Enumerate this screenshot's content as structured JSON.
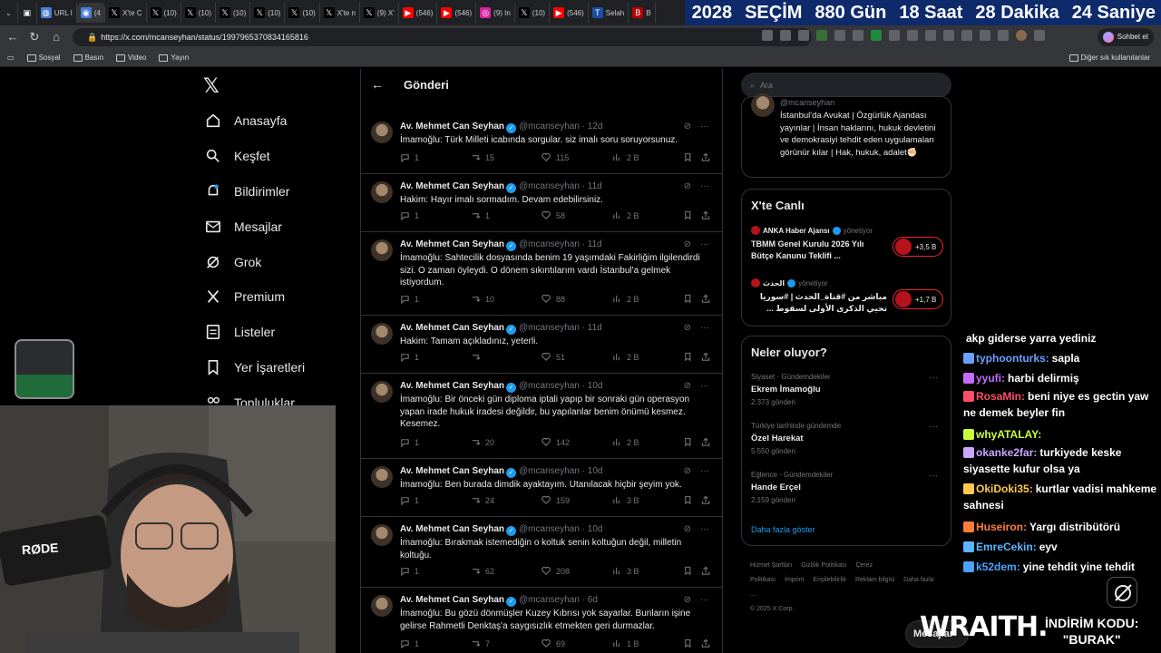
{
  "browser": {
    "tabs": [
      {
        "label": "URL I",
        "icon": "earth"
      },
      {
        "label": "(4",
        "icon": "circle"
      },
      {
        "label": "X'te C",
        "icon": "x"
      },
      {
        "label": "(10) ",
        "icon": "x"
      },
      {
        "label": "(10) ",
        "icon": "x"
      },
      {
        "label": "(10) ",
        "icon": "x"
      },
      {
        "label": "(10) ",
        "icon": "x"
      },
      {
        "label": "(10) ",
        "icon": "x"
      },
      {
        "label": "X'te n",
        "icon": "x"
      },
      {
        "label": "(9) X'",
        "icon": "x"
      },
      {
        "label": "(546)",
        "icon": "youtube"
      },
      {
        "label": "(546)",
        "icon": "youtube"
      },
      {
        "label": "(9) In",
        "icon": "instagram"
      },
      {
        "label": "(10) ",
        "icon": "x"
      },
      {
        "label": "(546)",
        "icon": "youtube"
      },
      {
        "label": "Selah",
        "icon": "tbn"
      },
      {
        "label": "B",
        "icon": "b"
      }
    ],
    "countdown": {
      "year": "2028",
      "label": "SEÇİM",
      "days": "880 Gün",
      "hours": "18 Saat",
      "minutes": "28 Dakika",
      "seconds": "24 Saniye"
    },
    "url": "https://x.com/mcanseyhan/status/1997965370834165816",
    "chat_button": "Sohbet et",
    "bookmarks": [
      "Sosyal",
      "Basın",
      "Video",
      "Yayın"
    ],
    "other_bookmarks": "Diğer sık kullanılanlar"
  },
  "nav": {
    "items": [
      {
        "label": "Anasayfa",
        "icon": "home-icon"
      },
      {
        "label": "Keşfet",
        "icon": "search-icon"
      },
      {
        "label": "Bildirimler",
        "icon": "bell-icon"
      },
      {
        "label": "Mesajlar",
        "icon": "mail-icon"
      },
      {
        "label": "Grok",
        "icon": "grok-icon"
      },
      {
        "label": "Premium",
        "icon": "x-icon"
      },
      {
        "label": "Listeler",
        "icon": "list-icon"
      },
      {
        "label": "Yer İşaretleri",
        "icon": "bookmark-icon"
      },
      {
        "label": "Topluluklar",
        "icon": "people-icon"
      }
    ]
  },
  "column": {
    "title": "Gönderi"
  },
  "tweets": [
    {
      "name": "Av. Mehmet Can Seyhan",
      "handle": "@mcanseyhan",
      "date": "· 12d",
      "text": "İmamoğlu: Türk Milleti icabında sorgular. siz imalı soru soruyorsunuz.",
      "replies": "1",
      "reposts": "15",
      "likes": "115",
      "views": "2 B"
    },
    {
      "name": "Av. Mehmet Can Seyhan",
      "handle": "@mcanseyhan",
      "date": "· 11d",
      "text": "Hakim: Hayır imalı sormadım. Devam edebilirsiniz.",
      "replies": "1",
      "reposts": "1",
      "likes": "58",
      "views": "2 B"
    },
    {
      "name": "Av. Mehmet Can Seyhan",
      "handle": "@mcanseyhan",
      "date": "· 11d",
      "text": "İmamoğlu: Sahtecilik dosyasında benim 19 yaşımdaki Fakirliğim ilgilendirdi sizi. O zaman öyleydi. O dönem sıkıntılarım vardı İstanbul'a gelmek istiyordum.",
      "replies": "1",
      "reposts": "10",
      "likes": "88",
      "views": "2 B"
    },
    {
      "name": "Av. Mehmet Can Seyhan",
      "handle": "@mcanseyhan",
      "date": "· 11d",
      "text": "Hakim: Tamam açıkladınız, yeterli.",
      "replies": "1",
      "reposts": "",
      "likes": "51",
      "views": "2 B"
    },
    {
      "name": "Av. Mehmet Can Seyhan",
      "handle": "@mcanseyhan",
      "date": "· 10d",
      "text": "İmamoğlu: Bir önceki gün diploma iptali yapıp bir sonraki gün operasyon yapan irade hukuk iradesi değildir, bu yapılanlar benim önümü kesmez. Kesemez.",
      "replies": "1",
      "reposts": "20",
      "likes": "142",
      "views": "2 B"
    },
    {
      "name": "Av. Mehmet Can Seyhan",
      "handle": "@mcanseyhan",
      "date": "· 10d",
      "text": "İmamoğlu: Ben burada dimdik ayaktayım. Utanılacak hiçbir şeyim yok.",
      "replies": "1",
      "reposts": "24",
      "likes": "159",
      "views": "3 B"
    },
    {
      "name": "Av. Mehmet Can Seyhan",
      "handle": "@mcanseyhan",
      "date": "· 10d",
      "text": "İmamoğlu: Bırakmak istemediğin o koltuk senin koltuğun değil, milletin koltuğu.",
      "replies": "1",
      "reposts": "62",
      "likes": "208",
      "views": "3 B"
    },
    {
      "name": "Av. Mehmet Can Seyhan",
      "handle": "@mcanseyhan",
      "date": "· 6d",
      "text": "İmamoğlu: Bu gözü dönmüşler Kuzey Kıbrısı yok sayarlar. Bunların işine gelirse Rahmetli Denktaş'a saygısızlık etmekten geri durmazlar.",
      "replies": "1",
      "reposts": "7",
      "likes": "69",
      "views": "1 B"
    }
  ],
  "search": {
    "placeholder": "Ara"
  },
  "profile": {
    "handle": "@mcanseyhan",
    "bio": "İstanbul'da Avukat | Özgürlük Ajandası yayınlar | İnsan haklarını, hukuk devletini ve demokrasiyi tehdit eden uygulamaları görünür kılar | Hak, hukuk, adalet✊🏻"
  },
  "live": {
    "title": "X'te Canlı",
    "items": [
      {
        "source": "ANKA Haber Ajansı",
        "status": "yönetiyor",
        "title": "TBMM Genel Kurulu 2026 Yılı Bütçe Kanunu Teklifi ...",
        "count": "+3,5 B"
      },
      {
        "source": "الحدث",
        "status": "yönetiyor",
        "title": "مباشر من #قناة_الحدث | #سوريا تحيي الذكرى الأولى لسقوط ...",
        "count": "+1,7 B"
      }
    ]
  },
  "trends": {
    "title": "Neler oluyor?",
    "items": [
      {
        "category": "Siyaset · Gündemdekiler",
        "topic": "Ekrem İmamoğlu",
        "count": "2.373 gönderi"
      },
      {
        "category": "Türkiye tarihinde gündemde",
        "topic": "Özel Harekat",
        "count": "5.550 gönderi"
      },
      {
        "category": "Eğlence · Gündemdekiler",
        "topic": "Hande Erçel",
        "count": "2.159 gönderi"
      }
    ],
    "more": "Daha fazla göster"
  },
  "footer": {
    "links": [
      "Hizmet Şartları",
      "Gizlilik Politikası",
      "Çerez Politikası",
      "İmprint",
      "Erişilebilirlik",
      "Reklam bilgisi",
      "Daha fazla ..."
    ],
    "copyright": "© 2025 X Corp."
  },
  "chat": [
    {
      "user": "",
      "text": "akp giderse yarra yediniz",
      "color": "#ffffff"
    },
    {
      "user": "typhoonturks:",
      "text": "sapla",
      "color": "#6aa0ff"
    },
    {
      "user": "yyufi:",
      "text": "harbi delirmiş",
      "color": "#c56cff"
    },
    {
      "user": "RosaMin:",
      "text": "beni niye es gectin yaw ne demek beyler fin",
      "color": "#ff4f6a"
    },
    {
      "user": "whyATALAY:",
      "text": "",
      "color": "#c8ff3a"
    },
    {
      "user": "okanke2far:",
      "text": "turkiyede keske siyasette kufur olsa ya",
      "color": "#c9a6ff"
    },
    {
      "user": "OkiDoki35:",
      "text": "kurtlar vadisi mahkeme sahnesi",
      "color": "#ffc94a"
    },
    {
      "user": "Huseiron:",
      "text": "Yargı distribütörü",
      "color": "#ff7d3a"
    },
    {
      "user": "EmreCekin:",
      "text": "eyv",
      "color": "#5ab6ff"
    },
    {
      "user": "k52dem:",
      "text": "yine tehdit yine tehdit",
      "color": "#4aa3ff"
    }
  ],
  "overlay": {
    "messages": "Mesajlar",
    "brand": "WRAITH.",
    "code_label": "İNDİRİM KODU:",
    "code": "\"BURAK\""
  },
  "webcam": {
    "mic_brand": "RØDE"
  }
}
